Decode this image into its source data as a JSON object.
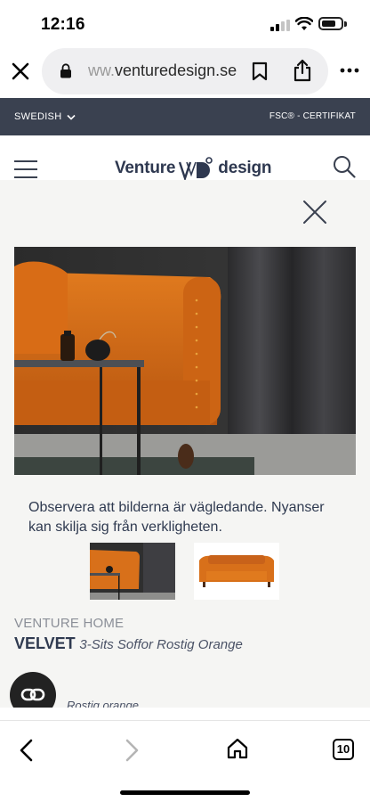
{
  "status_bar": {
    "time": "12:16"
  },
  "browser": {
    "url_prefix": "ww.",
    "url_domain": "venturedesign.se",
    "tab_count": "10"
  },
  "site": {
    "language_label": "SWEDISH",
    "fsc_label": "FSC® - CERTIFIKAT",
    "logo_left": "Venture",
    "logo_right": "design"
  },
  "modal": {
    "notice": "Observera att bilderna är vägledande. Nyanser kan skilja sig från verkligheten.",
    "brand": "VENTURE HOME",
    "product_name": "VELVET",
    "product_desc": "3-Sits Soffor Rostig Orange",
    "color_label": "Rostig orange"
  },
  "colors": {
    "header_bg": "#3a4150",
    "brand_navy": "#2e3850",
    "sofa_orange": "#d8701a",
    "modal_bg": "#f5f5f3"
  },
  "icons": [
    "close-icon",
    "lock-icon",
    "bookmark-icon",
    "share-icon",
    "more-icon",
    "chevron-down-icon",
    "hamburger-icon",
    "search-icon",
    "chat-icon",
    "back-icon",
    "forward-icon",
    "home-icon",
    "tabs-icon"
  ]
}
